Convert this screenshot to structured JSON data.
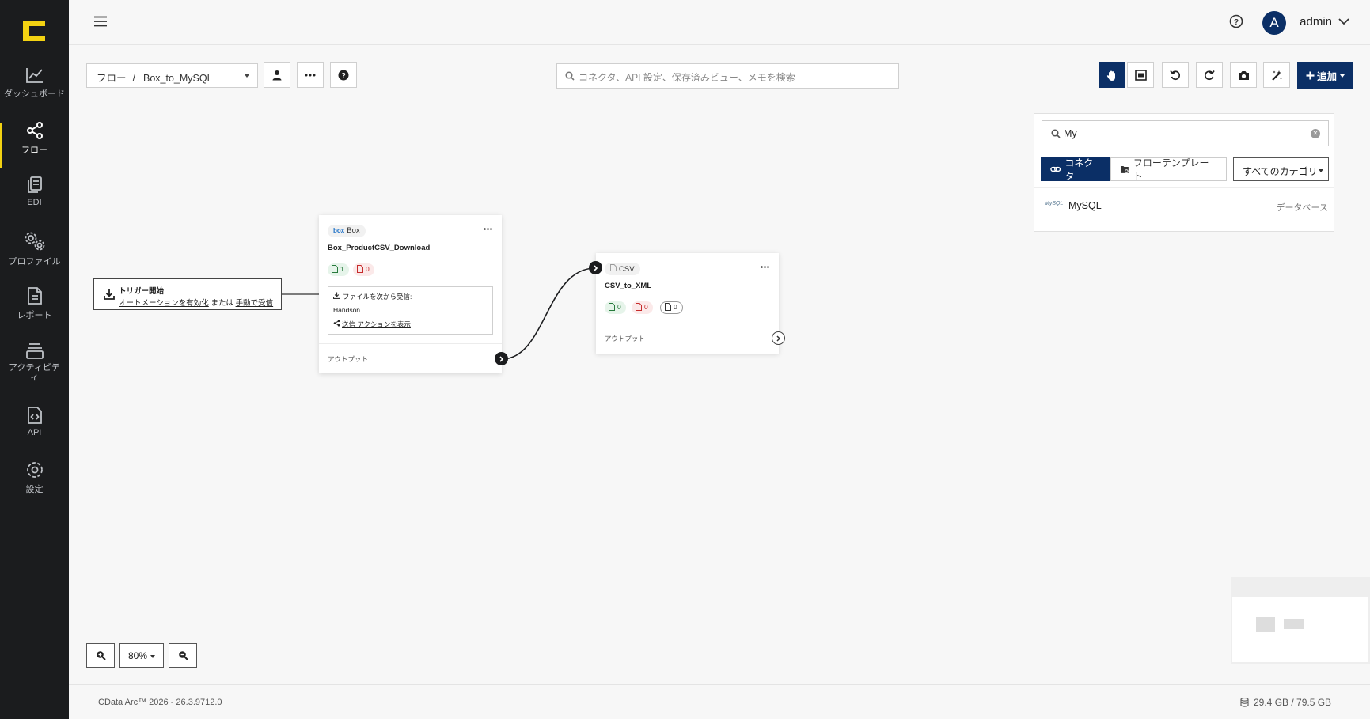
{
  "sidebar": {
    "items": [
      {
        "label": "ダッシュボード",
        "icon": "chart-line-icon"
      },
      {
        "label": "フロー",
        "icon": "share-nodes-icon",
        "active": true
      },
      {
        "label": "EDI",
        "icon": "copy-documents-icon"
      },
      {
        "label": "プロファイル",
        "icon": "gears-icon"
      },
      {
        "label": "レポート",
        "icon": "report-document-icon"
      },
      {
        "label": "アクティビティ",
        "icon": "stack-layers-icon"
      },
      {
        "label": "API",
        "icon": "api-file-icon"
      },
      {
        "label": "設定",
        "icon": "gear-icon"
      }
    ]
  },
  "header": {
    "username": "admin",
    "avatar_letter": "A"
  },
  "toolbar": {
    "breadcrumb_root": "フロー",
    "breadcrumb_sep": "/",
    "flow_name": "Box_to_MySQL",
    "search_placeholder": "コネクタ、API 設定、保存済みビュー、メモを検索",
    "add_label": "追加"
  },
  "canvas": {
    "trigger": {
      "title": "トリガー開始",
      "link_automation": "オートメーションを有効化",
      "or_text": "または",
      "link_manual": "手動で受信"
    },
    "nodes": [
      {
        "connector": "Box",
        "connector_brand": "box",
        "name": "Box_ProductCSV_Download",
        "count_success": "1",
        "count_error": "0",
        "receive_label": "ファイルを次から受信:",
        "receive_source": "Handson",
        "send_link": "送信 アクションを表示",
        "output_label": "アウトプット"
      },
      {
        "connector": "CSV",
        "name": "CSV_to_XML",
        "count_success": "0",
        "count_error": "0",
        "count_pending": "0",
        "output_label": "アウトプット"
      }
    ]
  },
  "connector_panel": {
    "search_value": "My",
    "tab_connectors": "コネクタ",
    "tab_templates": "フローテンプレート",
    "category_select": "すべてのカテゴリ",
    "results": [
      {
        "name": "MySQL",
        "logo_text": "MySQL",
        "category": "データベース"
      }
    ]
  },
  "zoom": {
    "level": "80%"
  },
  "footer": {
    "version": "CData Arc™ 2026 - 26.3.9712.0",
    "disk_usage": "29.4 GB / 79.5 GB"
  },
  "colors": {
    "brand_navy": "#0b2f66",
    "sidebar_bg": "#1b1c1e",
    "active_accent": "#f3d212",
    "success_green": "#277a3c",
    "error_red": "#c62b2b"
  }
}
